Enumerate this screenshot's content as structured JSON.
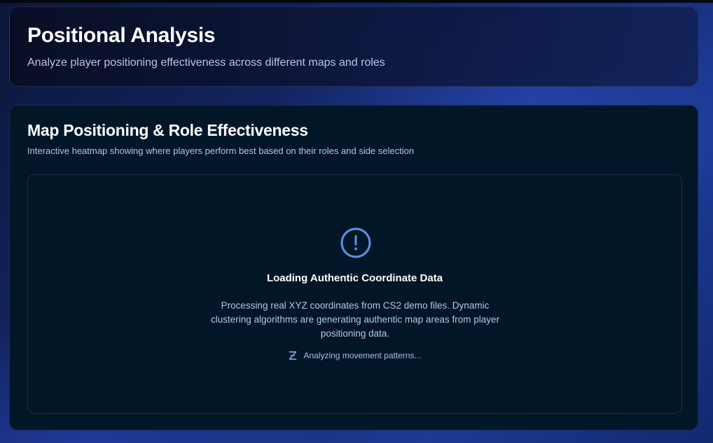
{
  "header": {
    "title": "Positional Analysis",
    "subtitle": "Analyze player positioning effectiveness across different maps and roles"
  },
  "section": {
    "title": "Map Positioning & Role Effectiveness",
    "subtitle": "Interactive heatmap showing where players perform best based on their roles and side selection"
  },
  "loading": {
    "icon": "alert-circle-icon",
    "title": "Loading Authentic Coordinate Data",
    "description": "Processing real XYZ coordinates from CS2 demo files. Dynamic clustering algorithms are generating authentic map areas from player positioning data.",
    "status_icon": "hourglass-icon",
    "status": "Analyzing movement patterns..."
  },
  "colors": {
    "accent": "#5b8fd9",
    "card_bg": "#011627",
    "text_muted": "#b7c6e6"
  }
}
